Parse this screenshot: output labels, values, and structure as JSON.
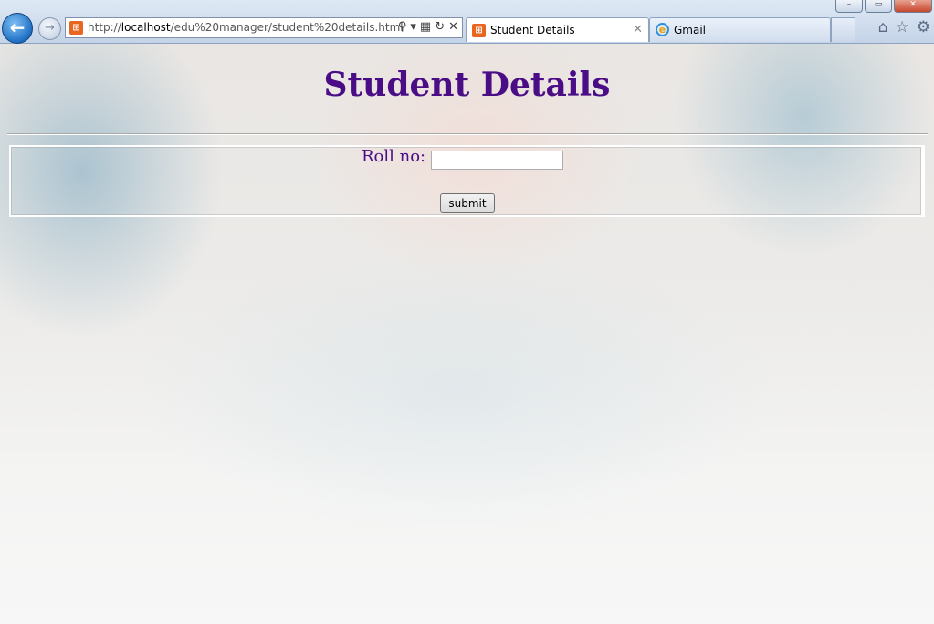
{
  "browser": {
    "url_prefix": "http://",
    "url_host": "localhost",
    "url_path": "/edu%20manager/student%20details.html",
    "tabs": [
      {
        "label": "Student Details",
        "icon": "xampp-icon",
        "active": true
      },
      {
        "label": "Gmail",
        "icon": "ie-icon",
        "active": false
      }
    ],
    "window_buttons": {
      "minimize": "–",
      "restore": "▭",
      "close": "✕"
    }
  },
  "page": {
    "heading": "Student Details",
    "form": {
      "roll_label": "Roll no:",
      "roll_value": "",
      "submit_label": "submit"
    }
  },
  "colors": {
    "heading": "#4b0d86",
    "label": "#4b0d86"
  }
}
